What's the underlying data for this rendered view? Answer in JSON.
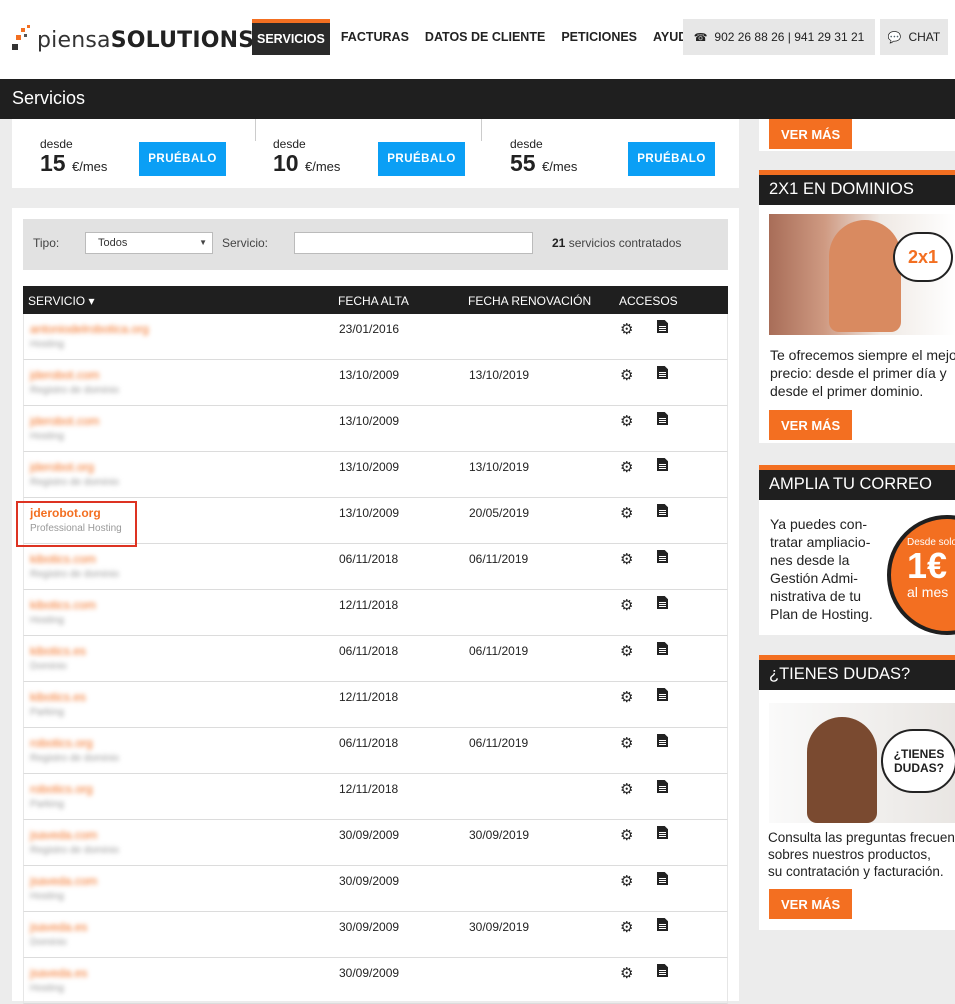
{
  "brand": {
    "name_light": "piensa",
    "name_bold": "SOLUTIONS"
  },
  "nav": {
    "items": [
      "SERVICIOS",
      "FACTURAS",
      "DATOS DE CLIENTE",
      "PETICIONES",
      "AYUDA"
    ]
  },
  "contact": {
    "phone": "902 26 88 26 | 941 29 31 21",
    "chat": "CHAT"
  },
  "page_title": "Servicios",
  "promo": {
    "plans": [
      {
        "desde": "desde",
        "price": "15",
        "unit": "€/mes",
        "button": "PRUÉBALO"
      },
      {
        "desde": "desde",
        "price": "10",
        "unit": "€/mes",
        "button": "PRUÉBALO"
      },
      {
        "desde": "desde",
        "price": "55",
        "unit": "€/mes",
        "button": "PRUÉBALO"
      }
    ]
  },
  "filter": {
    "tipo_label": "Tipo:",
    "tipo_value": "Todos",
    "servicio_label": "Servicio:",
    "count": "21",
    "count_text": "servicios contratados"
  },
  "table": {
    "headers": {
      "servicio": "SERVICIO ▾",
      "alta": "FECHA ALTA",
      "renovacion": "FECHA RENOVACIÓN",
      "accesos": "ACCESOS"
    },
    "rows": [
      {
        "name": "antoniodelrobotica.org",
        "type": "Hosting",
        "alta": "23/01/2016",
        "renovacion": ""
      },
      {
        "name": "jderobot.com",
        "type": "Registro de dominio",
        "alta": "13/10/2009",
        "renovacion": "13/10/2019"
      },
      {
        "name": "jderobot.com",
        "type": "Hosting",
        "alta": "13/10/2009",
        "renovacion": ""
      },
      {
        "name": "jderobot.org",
        "type": "Registro de dominio",
        "alta": "13/10/2009",
        "renovacion": "13/10/2019"
      },
      {
        "name": "jderobot.org",
        "type": "Professional Hosting",
        "alta": "13/10/2009",
        "renovacion": "20/05/2019"
      },
      {
        "name": "kibotics.com",
        "type": "Registro de dominio",
        "alta": "06/11/2018",
        "renovacion": "06/11/2019"
      },
      {
        "name": "kibotics.com",
        "type": "Hosting",
        "alta": "12/11/2018",
        "renovacion": ""
      },
      {
        "name": "kibotics.es",
        "type": "Dominio",
        "alta": "06/11/2018",
        "renovacion": "06/11/2019"
      },
      {
        "name": "kibotics.es",
        "type": "Parking",
        "alta": "12/11/2018",
        "renovacion": ""
      },
      {
        "name": "robotics.org",
        "type": "Registro de dominio",
        "alta": "06/11/2018",
        "renovacion": "06/11/2019"
      },
      {
        "name": "robotics.org",
        "type": "Parking",
        "alta": "12/11/2018",
        "renovacion": ""
      },
      {
        "name": "jsaveda.com",
        "type": "Registro de dominio",
        "alta": "30/09/2009",
        "renovacion": "30/09/2019"
      },
      {
        "name": "jsaveda.com",
        "type": "Hosting",
        "alta": "30/09/2009",
        "renovacion": ""
      },
      {
        "name": "jsaveda.es",
        "type": "Dominio",
        "alta": "30/09/2009",
        "renovacion": "30/09/2019"
      },
      {
        "name": "jsaveda.es",
        "type": "Hosting",
        "alta": "30/09/2009",
        "renovacion": ""
      }
    ]
  },
  "sidebar": {
    "top_button": "VER MÁS",
    "dominios": {
      "title": "2X1 EN DOMINIOS",
      "badge": "2x1",
      "text": [
        "Te ofrecemos siempre el mejor",
        "precio: desde el primer día y",
        "desde el primer dominio."
      ],
      "button": "VER MÁS"
    },
    "correo": {
      "title": "AMPLIA TU CORREO",
      "text": [
        "Ya puedes con-",
        "tratar ampliacio-",
        "nes desde la",
        "Gestión Admi-",
        "nistrativa de tu",
        "Plan de Hosting."
      ],
      "badge_top": "Desde solo",
      "badge_price": "1€",
      "badge_bottom": "al mes"
    },
    "dudas": {
      "title": "¿TIENES DUDAS?",
      "badge": "¿TIENES DUDAS?",
      "text": [
        "Consulta las preguntas frecuentes",
        "sobres nuestros productos,",
        "su contratación y facturación."
      ],
      "button": "VER MÁS"
    }
  },
  "colors": {
    "accent": "#f36f21",
    "blue": "#0b9ff5",
    "dark": "#1f1f1f"
  }
}
